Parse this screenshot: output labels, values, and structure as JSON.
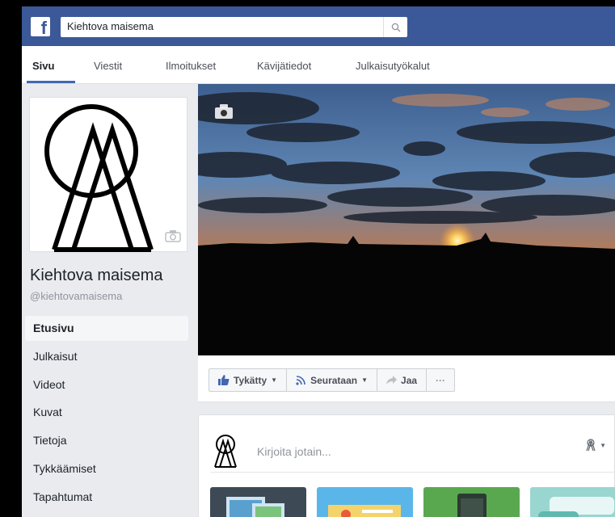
{
  "header": {
    "logo": "f",
    "search_value": "Kiehtova maisema"
  },
  "tabs": [
    {
      "label": "Sivu"
    },
    {
      "label": "Viestit"
    },
    {
      "label": "Ilmoitukset"
    },
    {
      "label": "Kävijätiedot"
    },
    {
      "label": "Julkaisutyökalut"
    }
  ],
  "page": {
    "name": "Kiehtova maisema",
    "handle": "@kiehtovamaisema"
  },
  "sidebar": {
    "items": [
      {
        "label": "Etusivu"
      },
      {
        "label": "Julkaisut"
      },
      {
        "label": "Videot"
      },
      {
        "label": "Kuvat"
      },
      {
        "label": "Tietoja"
      },
      {
        "label": "Tykkäämiset"
      },
      {
        "label": "Tapahtumat"
      }
    ]
  },
  "actions": {
    "like_label": "Tykätty",
    "follow_label": "Seurataan",
    "share_label": "Jaa",
    "more_label": "···"
  },
  "composer": {
    "placeholder": "Kirjoita jotain..."
  },
  "colors": {
    "brand": "#3b5998",
    "link": "#365899",
    "background": "#e9ebee"
  }
}
